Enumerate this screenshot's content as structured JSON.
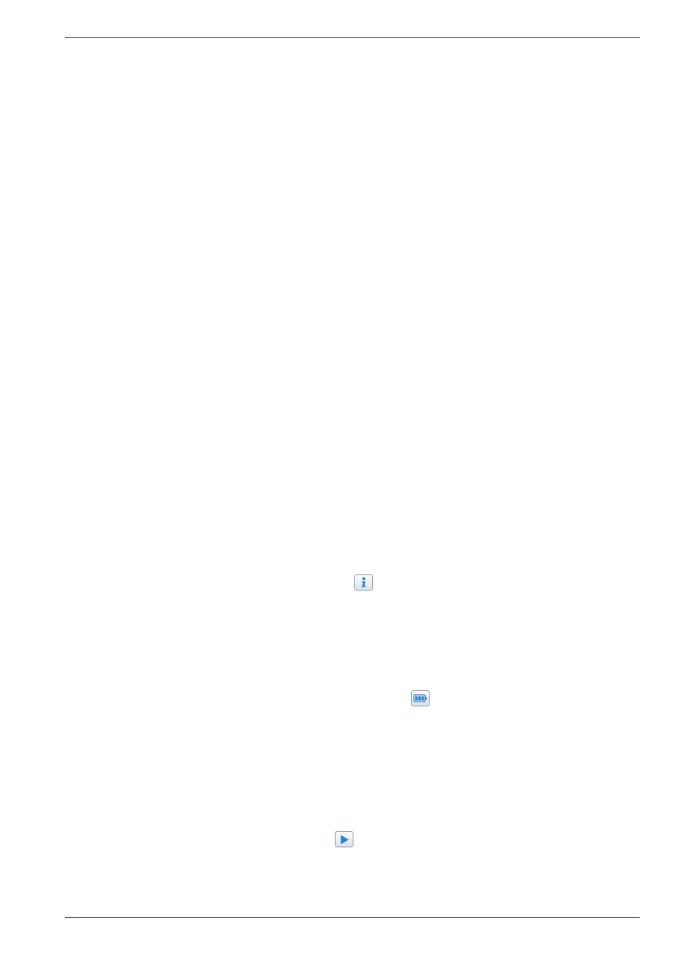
{
  "page": {
    "rule_color": "#b3282d"
  },
  "icons": [
    {
      "name": "info-icon",
      "accent": "#2f7fc8"
    },
    {
      "name": "battery-icon",
      "accent": "#2f7fc8"
    },
    {
      "name": "play-icon",
      "accent": "#2f7fc8"
    }
  ]
}
